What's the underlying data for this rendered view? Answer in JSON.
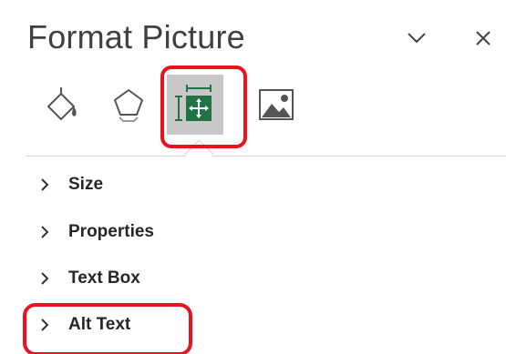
{
  "panel": {
    "title": "Format Picture"
  },
  "header_icons": {
    "menu": "chevron-down-icon",
    "close": "close-icon"
  },
  "tabs": [
    {
      "icon": "fill-line-icon",
      "selected": false
    },
    {
      "icon": "effects-icon",
      "selected": false
    },
    {
      "icon": "size-properties-icon",
      "selected": true
    },
    {
      "icon": "picture-icon",
      "selected": false
    }
  ],
  "sections": [
    {
      "label": "Size",
      "expanded": false
    },
    {
      "label": "Properties",
      "expanded": false
    },
    {
      "label": "Text Box",
      "expanded": false
    },
    {
      "label": "Alt Text",
      "expanded": false
    }
  ],
  "colors": {
    "selected_tab_bg": "#c8c8c8",
    "layout_icon_green": "#217346",
    "highlight": "#e8131f",
    "title_text": "#404040"
  }
}
